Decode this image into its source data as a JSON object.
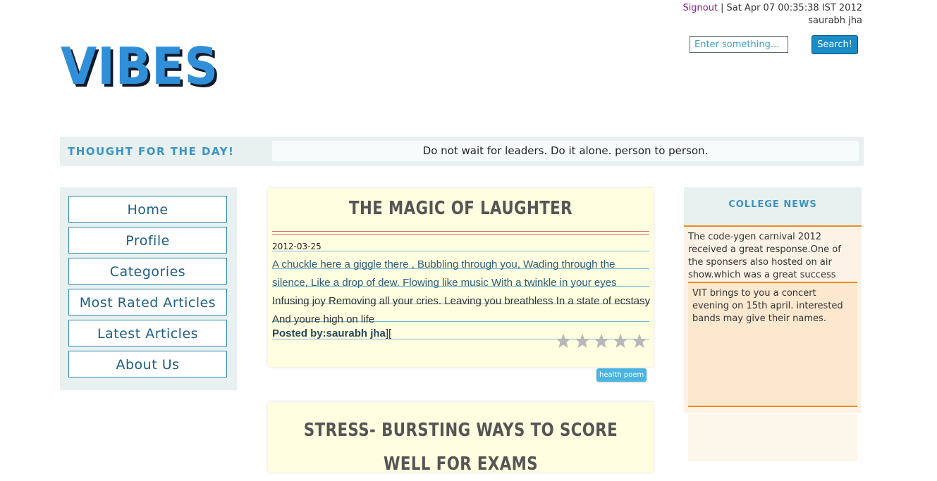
{
  "header": {
    "signout_label": "Signout",
    "separator": "|",
    "datetime": "Sat Apr 07 00:35:38 IST 2012",
    "username": "saurabh jha",
    "logo_text": "VIBES"
  },
  "search": {
    "placeholder": "Enter something...",
    "button_label": "Search!"
  },
  "thought": {
    "label": "THOUGHT FOR THE DAY!",
    "text": "Do not wait for leaders. Do it alone. person to person."
  },
  "nav": {
    "items": [
      {
        "label": "Home"
      },
      {
        "label": "Profile"
      },
      {
        "label": "Categories"
      },
      {
        "label": "Most Rated Articles"
      },
      {
        "label": "Latest Articles"
      },
      {
        "label": "About Us"
      }
    ]
  },
  "articles": [
    {
      "title": "THE MAGIC OF LAUGHTER",
      "date": "2012-03-25",
      "body_part1": "A chuckle here a giggle there , Bubbling through you, Wading through the silence, Like a drop of dew. Flowing like music With a twinkle in your eyes",
      "body_part2": "Infusing joy Removing all your cries. Leaving you breathless In a state of ecstasy And youre high on life",
      "posted_by": "Posted by:saurabh jha",
      "posted_suffix": "][",
      "rating": 0,
      "rating_max": 5,
      "tag": "health poem"
    },
    {
      "title": "STRESS- BURSTING WAYS TO SCORE WELL FOR EXAMS"
    }
  ],
  "news": {
    "title": "COLLEGE NEWS",
    "items": [
      "The code-ygen carnival 2012 received a great response.One of the sponsers also hosted on air show.which was a great success",
      "VIT brings to you a concert evening on 15th april. interested bands may give their names."
    ]
  },
  "colors": {
    "accent": "#2f8fd8",
    "news_border": "#f08a20",
    "article_bg": "#fefee0"
  }
}
